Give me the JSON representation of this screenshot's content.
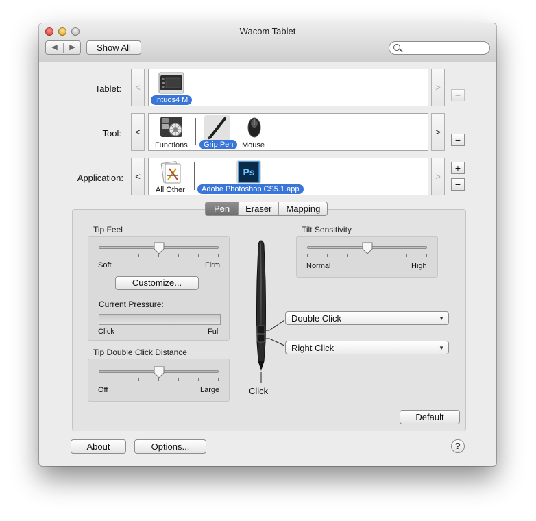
{
  "window": {
    "title": "Wacom Tablet"
  },
  "toolbar": {
    "back": "◀",
    "forward": "▶",
    "show_all": "Show All",
    "search_placeholder": ""
  },
  "rows": {
    "tablet": {
      "label": "Tablet:",
      "prev": "<",
      "next": ">",
      "selected": "Intuos4 M",
      "minus": "−"
    },
    "tool": {
      "label": "Tool:",
      "prev": "<",
      "next": ">",
      "items": [
        "Functions",
        "Grip Pen",
        "Mouse"
      ],
      "selected": "Grip Pen",
      "minus": "−"
    },
    "application": {
      "label": "Application:",
      "prev": "<",
      "next": ">",
      "items": [
        "All Other",
        "Adobe Photoshop CS5.1.app"
      ],
      "selected": "Adobe Photoshop CS5.1.app",
      "plus": "+",
      "minus": "−",
      "ps_glyph": "Ps"
    }
  },
  "tabs": [
    "Pen",
    "Eraser",
    "Mapping"
  ],
  "active_tab": "Pen",
  "tip_feel": {
    "title": "Tip Feel",
    "min_label": "Soft",
    "max_label": "Firm",
    "value_fraction": 0.5,
    "customize": "Customize...",
    "current_pressure_label": "Current Pressure:",
    "pressure_min": "Click",
    "pressure_max": "Full",
    "pressure_fraction": 0
  },
  "tip_double_click": {
    "title": "Tip Double Click Distance",
    "min_label": "Off",
    "max_label": "Large",
    "value_fraction": 0.5
  },
  "tilt": {
    "title": "Tilt Sensitivity",
    "min_label": "Normal",
    "max_label": "High",
    "value_fraction": 0.5
  },
  "pen_buttons": {
    "upper": "Double Click",
    "lower": "Right Click",
    "tip": "Click"
  },
  "footer": {
    "default": "Default",
    "about": "About",
    "options": "Options...",
    "help": "?"
  },
  "colors": {
    "selection": "#3a76d8",
    "ps_blue": "#2a8ad8",
    "ps_dark": "#0b2a4a"
  },
  "icons": {
    "back": "chevron-left-icon",
    "forward": "chevron-right-icon",
    "search": "search-icon",
    "tablet": "tablet-icon",
    "functions": "functions-icon",
    "pen": "pen-icon",
    "mouse": "mouse-icon",
    "all_other": "all-other-apps-icon",
    "photoshop": "photoshop-icon",
    "help": "help-icon"
  }
}
